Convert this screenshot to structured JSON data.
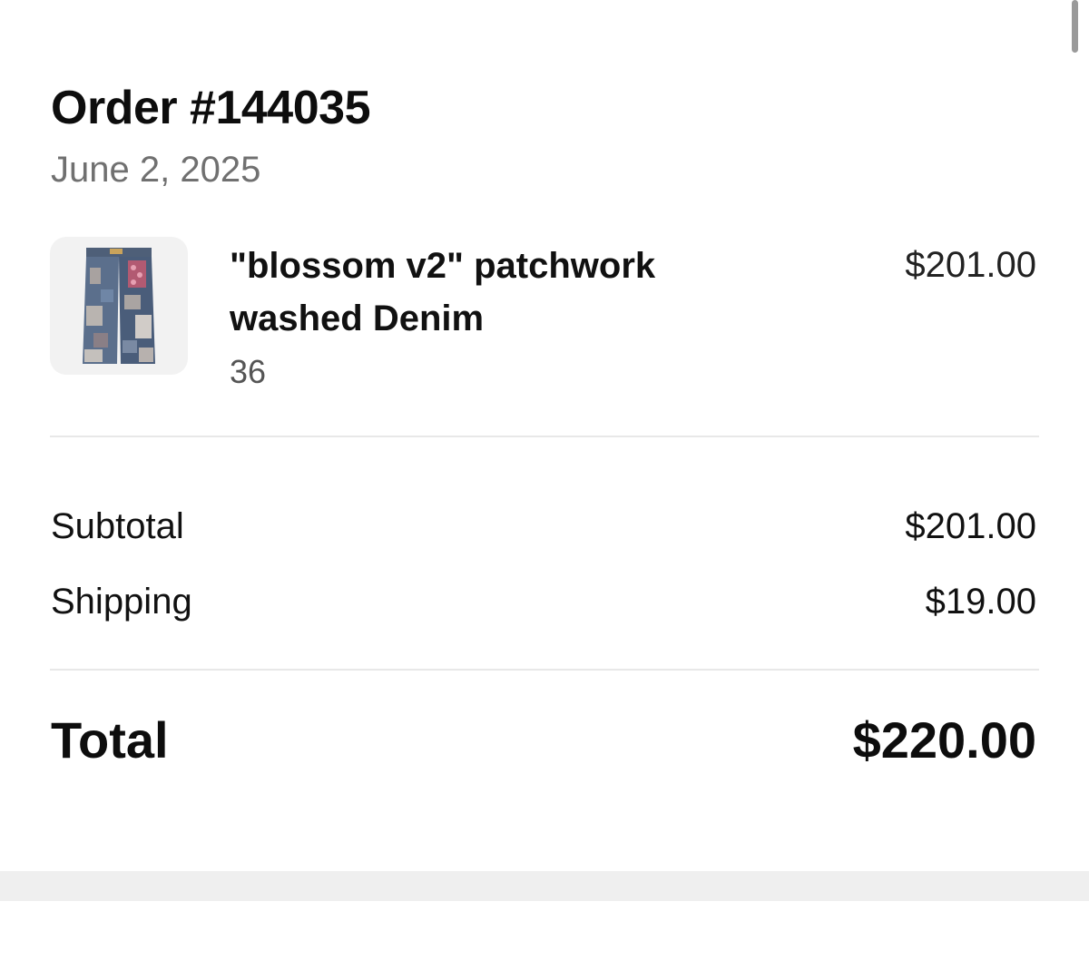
{
  "order": {
    "title": "Order #144035",
    "date": "June 2, 2025"
  },
  "line_items": [
    {
      "name": "\"blossom v2\" patchwork washed Denim",
      "variant": "36",
      "price": "$201.00",
      "thumbnail_icon": "patchwork-jeans-image"
    }
  ],
  "summary": {
    "subtotal_label": "Subtotal",
    "subtotal_value": "$201.00",
    "shipping_label": "Shipping",
    "shipping_value": "$19.00",
    "total_label": "Total",
    "total_value": "$220.00"
  },
  "colors": {
    "text_primary": "#111111",
    "text_secondary": "#707070",
    "divider": "#e8e8e8",
    "thumbnail_bg": "#f2f2f2",
    "bottom_band": "#efefef"
  }
}
